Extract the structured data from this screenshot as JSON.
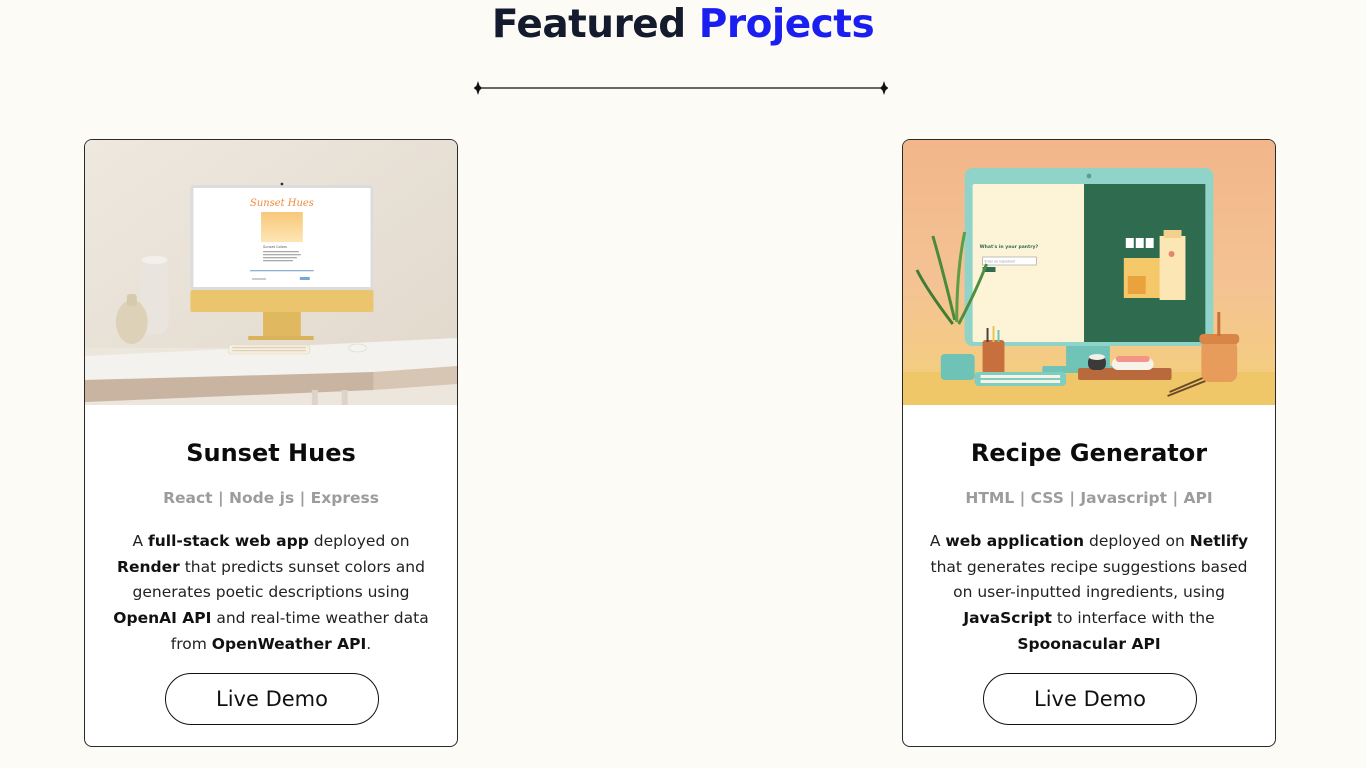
{
  "header": {
    "title_prefix": "Featured",
    "title_accent": "Projects"
  },
  "colors": {
    "accent": "#1a1ef0",
    "title": "#141b2d",
    "tags": "#9c9c9c",
    "background": "#fdfbf5"
  },
  "projects": [
    {
      "title": "Sunset Hues",
      "tags": "React | Node js | Express",
      "description": [
        {
          "t": "A "
        },
        {
          "t": "full-stack web app",
          "b": true
        },
        {
          "t": " deployed on "
        },
        {
          "t": "Render",
          "b": true
        },
        {
          "t": " that predicts sunset colors and generates poetic descriptions using "
        },
        {
          "t": "OpenAI API",
          "b": true
        },
        {
          "t": " and real-time weather data from "
        },
        {
          "t": "OpenWeather API",
          "b": true
        },
        {
          "t": "."
        }
      ],
      "button": "Live Demo",
      "image": {
        "screen_title": "Sunset Hues",
        "screen_heading": "Sunset Colors"
      }
    },
    {
      "title": "Recipe Generator",
      "tags": "HTML | CSS | Javascript | API",
      "description": [
        {
          "t": "A "
        },
        {
          "t": "web application",
          "b": true
        },
        {
          "t": " deployed on "
        },
        {
          "t": "Netlify",
          "b": true
        },
        {
          "t": " that generates recipe suggestions based on user-inputted ingredients, using "
        },
        {
          "t": "JavaScript",
          "b": true
        },
        {
          "t": " to interface with the "
        },
        {
          "t": "Spoonacular API",
          "b": true
        }
      ],
      "button": "Live Demo",
      "image": {
        "screen_heading": "What's in your pantry?",
        "screen_input": "Enter an ingredient"
      }
    }
  ]
}
